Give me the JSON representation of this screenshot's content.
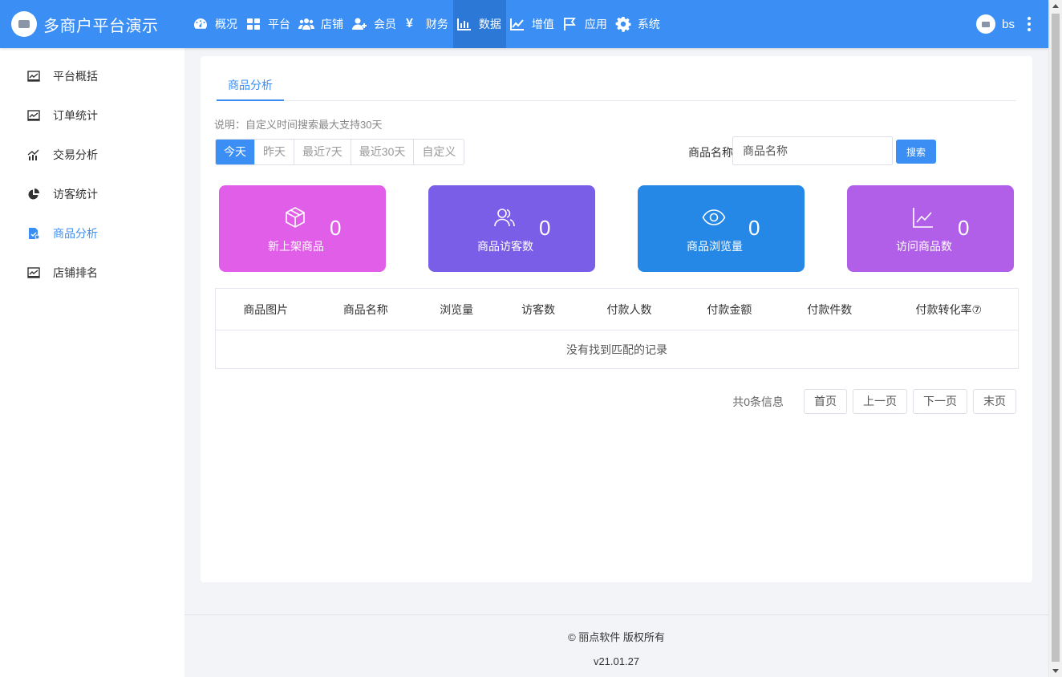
{
  "app": {
    "title": "多商户平台演示"
  },
  "nav": {
    "items": [
      {
        "label": "概况",
        "icon": "dashboard-icon"
      },
      {
        "label": "平台",
        "icon": "grid-icon"
      },
      {
        "label": "店铺",
        "icon": "users-group-icon"
      },
      {
        "label": "会员",
        "icon": "user-plus-icon"
      },
      {
        "label": "财务",
        "icon": "yen-icon"
      },
      {
        "label": "数据",
        "icon": "bar-chart-icon",
        "active": true
      },
      {
        "label": "增值",
        "icon": "line-chart-icon"
      },
      {
        "label": "应用",
        "icon": "flag-icon"
      },
      {
        "label": "系统",
        "icon": "gear-icon"
      }
    ],
    "yen_symbol": "¥"
  },
  "user": {
    "name": "bs"
  },
  "sidebar": {
    "items": [
      {
        "label": "平台概括",
        "icon": "line-chart-icon"
      },
      {
        "label": "订单统计",
        "icon": "line-chart-icon"
      },
      {
        "label": "交易分析",
        "icon": "trend-chart-icon"
      },
      {
        "label": "访客统计",
        "icon": "pie-chart-icon"
      },
      {
        "label": "商品分析",
        "icon": "goods-chart-icon",
        "active": true
      },
      {
        "label": "店铺排名",
        "icon": "line-chart-icon"
      }
    ]
  },
  "page": {
    "tab": "商品分析",
    "hint": "说明：自定义时间搜索最大支持30天",
    "ranges": [
      "今天",
      "昨天",
      "最近7天",
      "最近30天",
      "自定义"
    ],
    "active_range": "今天",
    "search": {
      "label": "商品名称",
      "placeholder": "商品名称",
      "value": "",
      "button": "搜索"
    }
  },
  "stats": [
    {
      "label": "新上架商品",
      "value": "0",
      "icon": "box-icon",
      "color": "#e15ee8"
    },
    {
      "label": "商品访客数",
      "value": "0",
      "icon": "users-icon",
      "color": "#7b5ee8"
    },
    {
      "label": "商品浏览量",
      "value": "0",
      "icon": "eye-icon",
      "color": "#2588e6"
    },
    {
      "label": "访问商品数",
      "value": "0",
      "icon": "line-chart-icon",
      "color": "#b15ee8"
    }
  ],
  "table": {
    "columns": [
      "商品图片",
      "商品名称",
      "浏览量",
      "访客数",
      "付款人数",
      "付款金额",
      "付款件数",
      "付款转化率⑦"
    ],
    "empty_text": "没有找到匹配的记录"
  },
  "pager": {
    "total": "共0条信息",
    "first": "首页",
    "prev": "上一页",
    "next": "下一页",
    "last": "末页"
  },
  "footer": {
    "copyright": "© 丽点软件 版权所有",
    "version": "v21.01.27"
  },
  "colors": {
    "primary": "#3b8ff4",
    "nav_active": "#2b78d6"
  }
}
